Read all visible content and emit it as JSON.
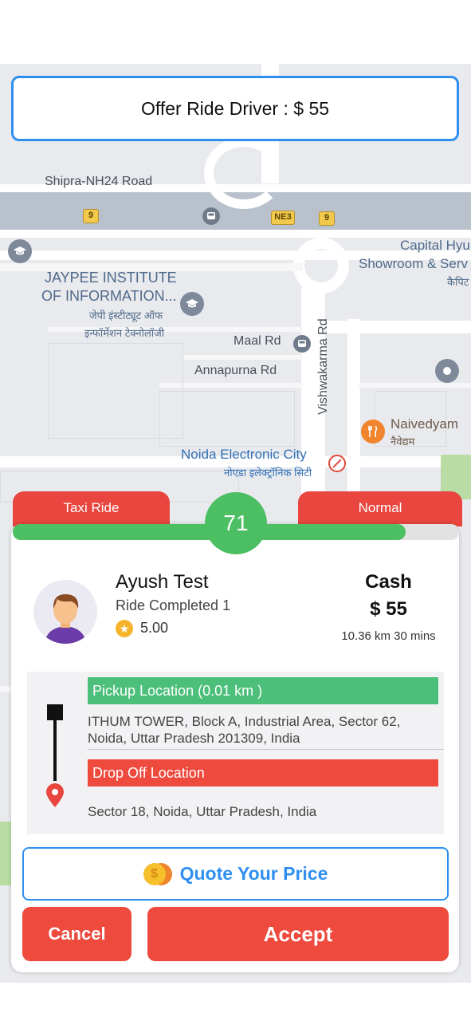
{
  "offer_banner": "Offer Ride Driver : $ 55",
  "map": {
    "roads": [
      "Shipra-NH24 Road",
      "Maal Rd",
      "Annapurna Rd",
      "Vishwakarma Rd"
    ],
    "route_shields": [
      "9",
      "NE3",
      "9"
    ],
    "places": [
      {
        "name": "JAYPEE INSTITUTE",
        "line2": "OF INFORMATION...",
        "hindi1": "जेपी इंस्टीट्यूट ऑफ",
        "hindi2": "इन्फॉर्मेशन टेक्नोलॉजी"
      },
      {
        "name": "Capital Hyu",
        "line2": "Showroom & Serv",
        "hindi": "कैपिट"
      },
      {
        "name": "Naivedyam",
        "hindi": "नैवेद्यम"
      },
      {
        "name": "Noida Electronic City",
        "hindi": "नोएडा इलेक्ट्रॉनिक सिटी"
      }
    ]
  },
  "ride": {
    "type_tab": "Taxi Ride",
    "class_tab": "Normal",
    "timer": "71",
    "timer_progress_fraction": 0.88
  },
  "rider": {
    "name": "Ayush Test",
    "rides_completed": "Ride Completed 1",
    "rating": "5.00"
  },
  "payment": {
    "method": "Cash",
    "fare": "$ 55",
    "trip_info": "10.36 km 30 mins"
  },
  "pickup": {
    "header": "Pickup Location (0.01 km )",
    "address": "ITHUM TOWER, Block A, Industrial Area, Sector 62, Noida, Uttar Pradesh 201309, India"
  },
  "dropoff": {
    "header": "Drop Off Location",
    "address": "Sector 18, Noida, Uttar Pradesh, India"
  },
  "actions": {
    "quote": "Quote Your Price",
    "cancel": "Cancel",
    "accept": "Accept"
  },
  "colors": {
    "primary_blue": "#2f8ff0",
    "accent_red": "#ee4a3d",
    "success_green": "#4cbf63",
    "map_bg": "#e9eaee"
  },
  "icons": [
    "graduation-cap-icon",
    "bus-stop-icon",
    "restaurant-icon",
    "metro-icon",
    "location-pin-icon",
    "star-icon",
    "coin-icon",
    "drop-pin-icon"
  ]
}
